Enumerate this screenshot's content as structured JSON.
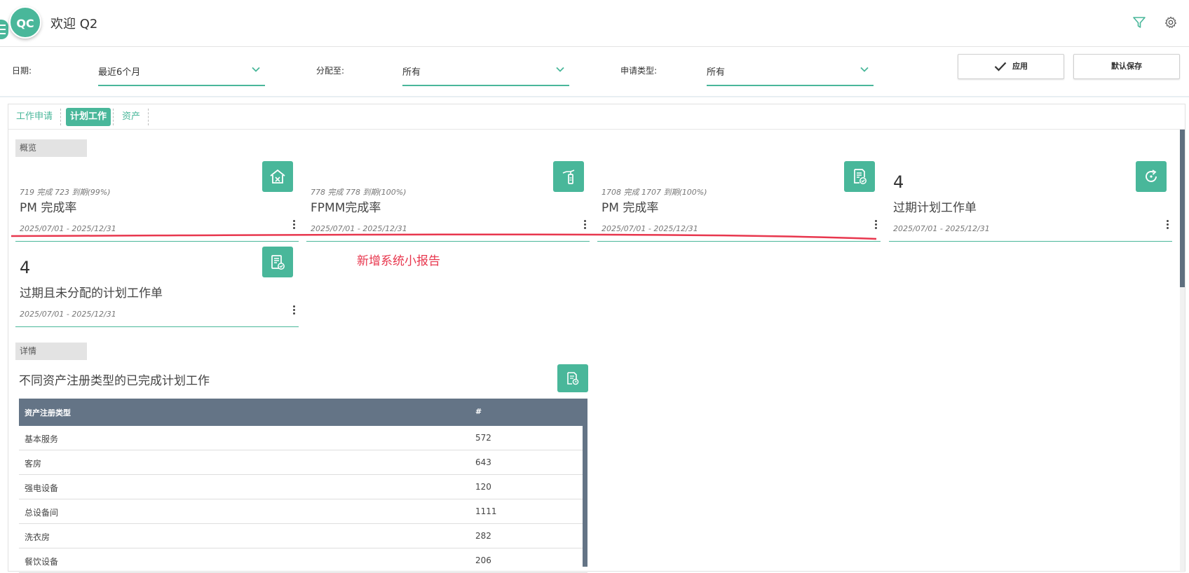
{
  "header": {
    "avatar_initials": "QC",
    "welcome": "欢迎 Q2",
    "accent": "#49b79a"
  },
  "filters": {
    "date": {
      "label": "日期:",
      "value": "最近6个月"
    },
    "assign": {
      "label": "分配至:",
      "value": "所有"
    },
    "request_type": {
      "label": "申请类型:",
      "value": "所有"
    },
    "apply_label": "应用",
    "save_default_label": "默认保存"
  },
  "tabs": [
    {
      "label": "工作申请",
      "active": false
    },
    {
      "label": "计划工作",
      "active": true
    },
    {
      "label": "资产",
      "active": false
    }
  ],
  "overview": {
    "label": "概览",
    "cards": [
      {
        "sub": "719 完成 723 到期(99%)",
        "title": "PM 完成率",
        "date": "2025/07/01 - 2025/12/31",
        "icon": "house-tools-icon"
      },
      {
        "sub": "778 完成 778 到期(100%)",
        "title": "FPMM完成率",
        "date": "2025/07/01 - 2025/12/31",
        "icon": "fire-extinguisher-icon"
      },
      {
        "sub": "1708 完成 1707 到期(100%)",
        "title": "PM 完成率",
        "date": "2025/07/01 - 2025/12/31",
        "icon": "document-check-icon"
      },
      {
        "big": "4",
        "title": "过期计划工作单",
        "date": "2025/07/01 - 2025/12/31",
        "icon": "refresh-icon"
      },
      {
        "big": "4",
        "title": "过期且未分配的计划工作单",
        "date": "2025/07/01 - 2025/12/31",
        "icon": "clipboard-check-icon"
      }
    ]
  },
  "annotation": {
    "text": "新增系统小报告",
    "color": "#e8374e"
  },
  "details": {
    "label": "详情",
    "title": "不同资产注册类型的已完成计划工作",
    "columns": [
      "资产注册类型",
      "#"
    ],
    "rows": [
      {
        "type": "基本服务",
        "count": "572"
      },
      {
        "type": "客房",
        "count": "643"
      },
      {
        "type": "强电设备",
        "count": "120"
      },
      {
        "type": "总设备间",
        "count": "1111"
      },
      {
        "type": "洗衣房",
        "count": "282"
      },
      {
        "type": "餐饮设备",
        "count": "206"
      }
    ]
  }
}
